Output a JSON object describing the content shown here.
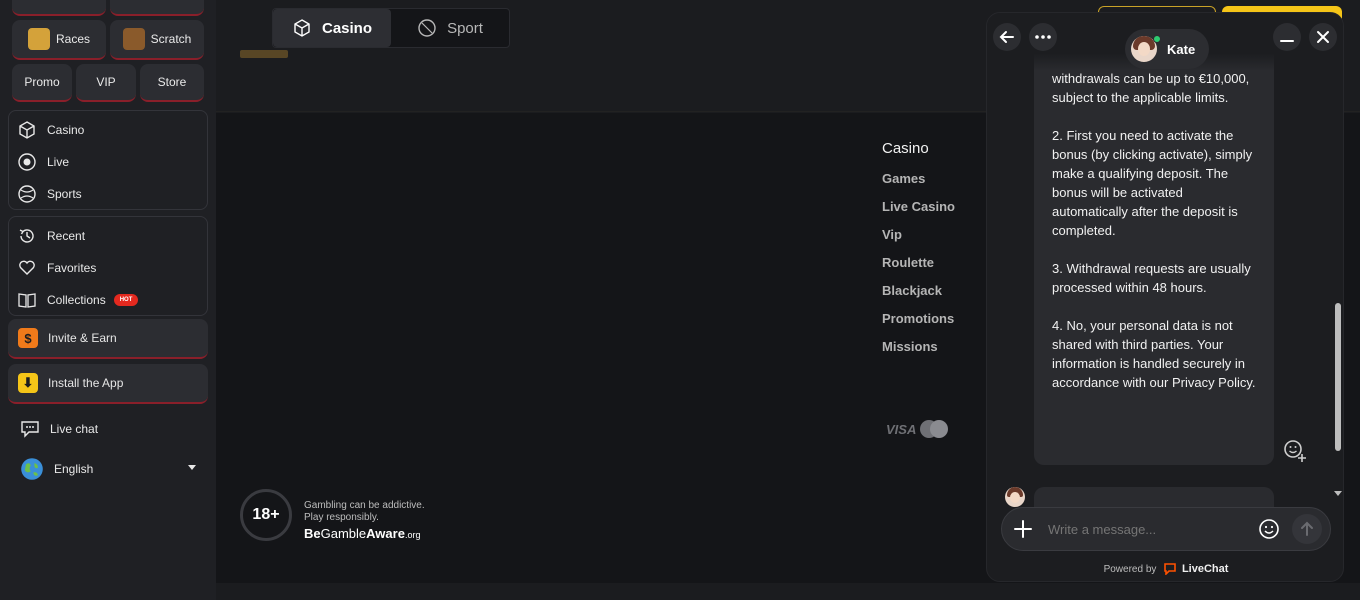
{
  "sidebar": {
    "tiles": [
      {
        "label": "Races"
      },
      {
        "label": "Scratch"
      },
      {
        "label": "Promo"
      },
      {
        "label": "VIP"
      },
      {
        "label": "Store"
      }
    ],
    "nav_main": [
      {
        "label": "Casino",
        "icon": "dice-icon"
      },
      {
        "label": "Live",
        "icon": "live-icon"
      },
      {
        "label": "Sports",
        "icon": "ball-icon"
      }
    ],
    "nav_personal": [
      {
        "label": "Recent",
        "icon": "history-icon"
      },
      {
        "label": "Favorites",
        "icon": "heart-icon"
      },
      {
        "label": "Collections",
        "icon": "book-icon",
        "badge": "HOT"
      }
    ],
    "invite": "Invite & Earn",
    "install": "Install the App",
    "live_chat": "Live chat",
    "language": "English"
  },
  "header": {
    "tabs": [
      {
        "label": "Casino",
        "active": true
      },
      {
        "label": "Sport",
        "active": false
      }
    ]
  },
  "footer": {
    "column_title": "Casino",
    "links": [
      "Games",
      "Live Casino",
      "Vip",
      "Roulette",
      "Blackjack",
      "Promotions",
      "Missions"
    ],
    "payment_visa": "VISA",
    "age_badge": "18+",
    "gamble_line1": "Gambling can be addictive.",
    "gamble_line2": "Play responsibly.",
    "gamble_brand_be": "Be",
    "gamble_brand_gamble": "Gamble",
    "gamble_brand_aware": "Aware",
    "gamble_brand_org": ".org"
  },
  "chat": {
    "agent_name": "Kate",
    "message_paragraphs": [
      "withdrawals can be up to €10,000, subject to the applicable limits.",
      "2. First you need to activate the bonus (by clicking activate), simply make a qualifying deposit. The bonus will be activated automatically after the deposit is completed.",
      "3. Withdrawal requests are usually processed within 48 hours.",
      "4. No, your personal data is not shared with third parties. Your information is handled securely in accordance with our Privacy Policy."
    ],
    "input_placeholder": "Write a message...",
    "powered_by": "Powered by",
    "powered_brand": "LiveChat"
  },
  "colors": {
    "accent_red": "#8a1f2a",
    "hot_badge": "#e4291f",
    "brand_yellow": "#f5c518",
    "online_green": "#2ecc71",
    "livechat_orange": "#ff5100"
  }
}
